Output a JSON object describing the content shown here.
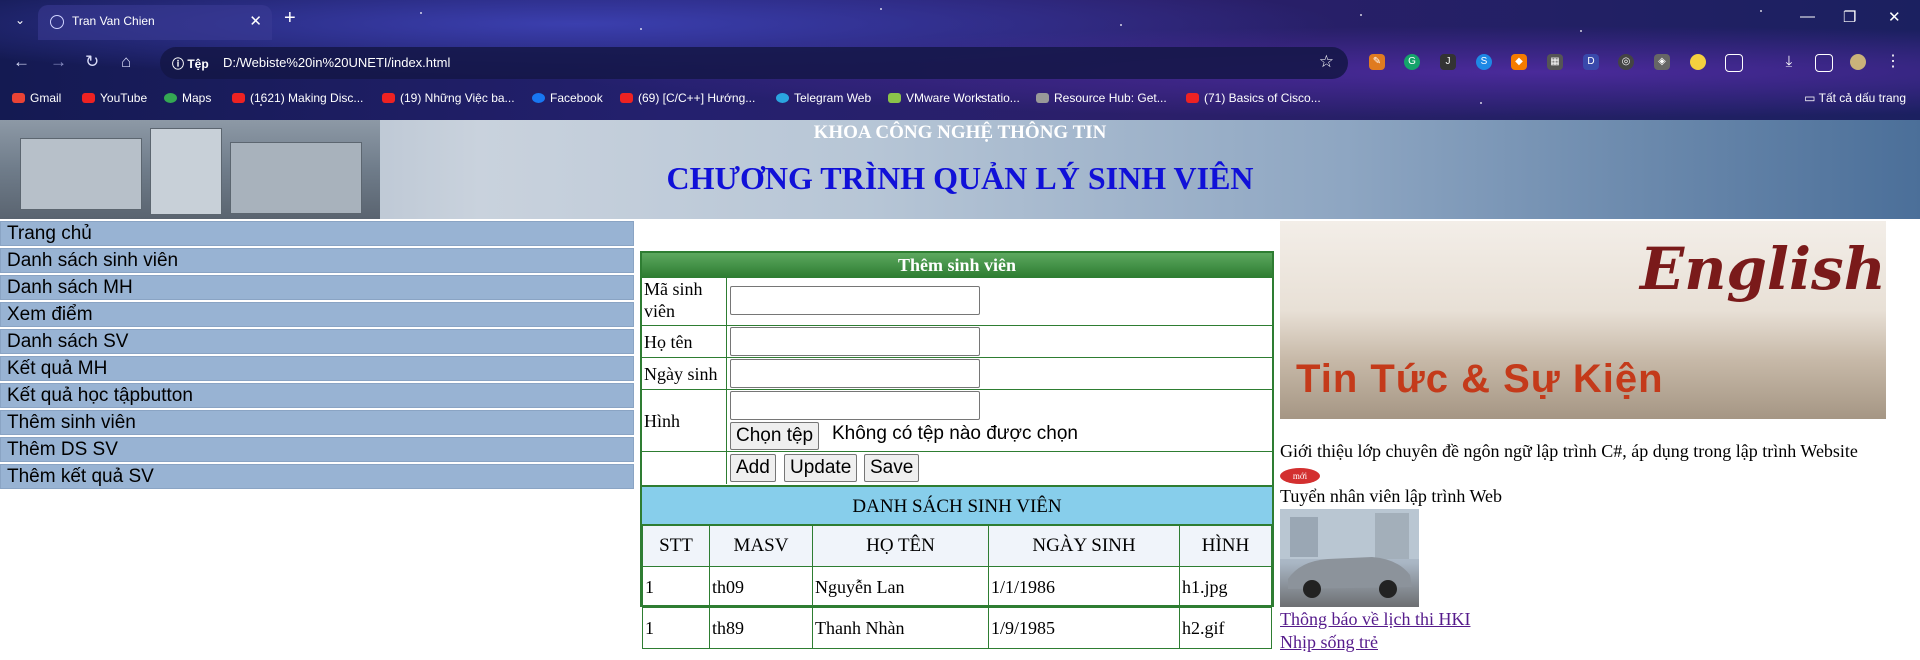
{
  "browser": {
    "tab_title": "Tran Van Chien",
    "omnibox_label": "Tệp",
    "url": "D:/Webiste%20in%20UNETI/index.html",
    "bookmarks": [
      {
        "label": "Gmail"
      },
      {
        "label": "YouTube"
      },
      {
        "label": "Maps"
      },
      {
        "label": "(1621) Making Disc..."
      },
      {
        "label": "(19) Những Việc ba..."
      },
      {
        "label": "Facebook"
      },
      {
        "label": "(69) [C/C++] Hướng..."
      },
      {
        "label": "Telegram Web"
      },
      {
        "label": "VMware Workstatio..."
      },
      {
        "label": "Resource Hub: Get..."
      },
      {
        "label": "(71) Basics of Cisco..."
      }
    ],
    "all_bookmarks": "Tất cả dấu trang"
  },
  "header": {
    "subtitle": "KHOA CÔNG NGHỆ THÔNG TIN",
    "title": "CHƯƠNG TRÌNH QUẢN LÝ SINH VIÊN"
  },
  "menu": [
    "Trang chủ",
    "Danh sách sinh viên",
    "Danh sách MH",
    "Xem điểm",
    "Danh sách SV",
    "Kết quả MH",
    "Kết quả học tậpbutton",
    "Thêm sinh viên",
    "Thêm DS SV",
    "Thêm kết quả SV"
  ],
  "form": {
    "title": "Thêm sinh viên",
    "label_ma": "Mã sinh viên",
    "label_hoten": "Họ tên",
    "label_ngaysinh": "Ngày sinh",
    "label_hinh": "Hình",
    "file_button": "Chọn tệp",
    "file_status": "Không có tệp nào được chọn",
    "btn_add": "Add",
    "btn_update": "Update",
    "btn_save": "Save"
  },
  "student_list": {
    "title": "DANH SÁCH SINH VIÊN",
    "columns": [
      "STT",
      "MASV",
      "HỌ TÊN",
      "NGÀY SINH",
      "HÌNH"
    ],
    "rows": [
      [
        "1",
        "th09",
        "Nguyễn Lan",
        "1/1/1986",
        "h1.jpg"
      ],
      [
        "1",
        "th89",
        "Thanh Nhàn",
        "1/9/1985",
        "h2.gif"
      ]
    ]
  },
  "sidebar_right": {
    "banner_word": "English",
    "banner_sub": "Tin Tức & Sự Kiện",
    "intro_text": "Giới thiệu lớp chuyên đề ngôn ngữ lập trình C#, áp dụng trong lập trình Website",
    "new_badge": "mới",
    "job_text": "Tuyển nhân viên lập trình Web",
    "link1": "Thông báo về lịch thi HKI",
    "link2": "Nhịp sống trẻ"
  }
}
